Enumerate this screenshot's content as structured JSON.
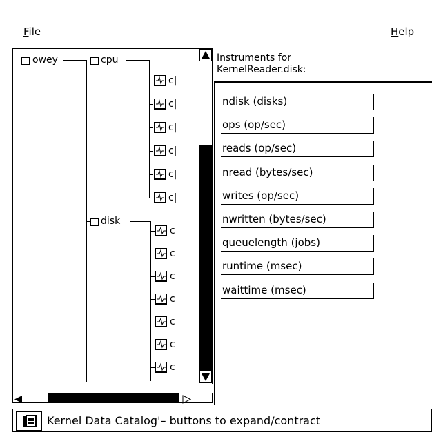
{
  "menubar": {
    "file": {
      "mnemonic": "F",
      "rest": "ile"
    },
    "help": {
      "mnemonic": "H",
      "rest": "elp"
    }
  },
  "tree": {
    "root_label": "owey",
    "groups": [
      {
        "label": "cpu",
        "leaf_label": "c|",
        "leaf_count": 6
      },
      {
        "label": "disk",
        "leaf_label": "c",
        "leaf_count": 7
      }
    ]
  },
  "instruments": {
    "title_line1": "Instruments for",
    "title_line2": "KernelReader.disk:",
    "items": [
      "ndisk (disks)",
      "ops (op/sec)",
      "reads (op/sec)",
      "nread (bytes/sec)",
      "writes (op/sec)",
      "nwritten (bytes/sec)",
      "queuelength (jobs)",
      "runtime (msec)",
      "waittime (msec)"
    ]
  },
  "status": {
    "text": "Kernel Data Catalog'– buttons to expand/contract",
    "icon": "catalog-icon"
  }
}
